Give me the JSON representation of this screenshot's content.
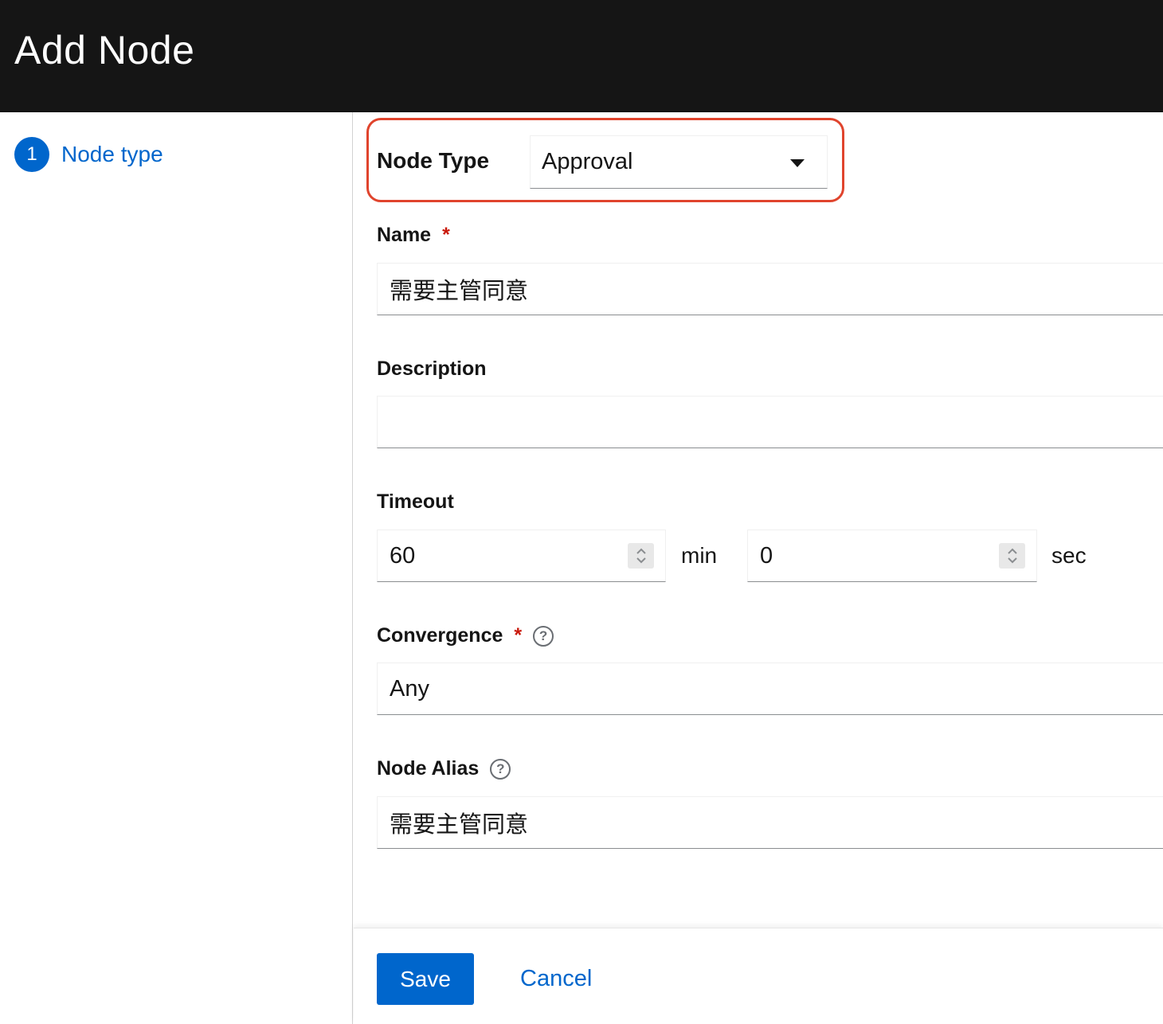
{
  "header": {
    "title": "Add Node"
  },
  "wizard_nav": {
    "steps": [
      {
        "number": "1",
        "label": "Node type"
      }
    ]
  },
  "form": {
    "node_type": {
      "label": "Node Type",
      "value": "Approval"
    },
    "name": {
      "label": "Name",
      "required_mark": "*",
      "value": "需要主管同意"
    },
    "description": {
      "label": "Description",
      "value": ""
    },
    "timeout": {
      "label": "Timeout",
      "minutes": "60",
      "minutes_unit": "min",
      "seconds": "0",
      "seconds_unit": "sec"
    },
    "convergence": {
      "label": "Convergence",
      "required_mark": "*",
      "help_icon": "question-circle-icon",
      "value": "Any"
    },
    "node_alias": {
      "label": "Node Alias",
      "help_icon": "question-circle-icon",
      "value": "需要主管同意"
    }
  },
  "footer": {
    "save_label": "Save",
    "cancel_label": "Cancel"
  },
  "colors": {
    "header_bg": "#151515",
    "accent": "#0066cc",
    "highlight": "#e0442d",
    "required": "#c9190b"
  }
}
